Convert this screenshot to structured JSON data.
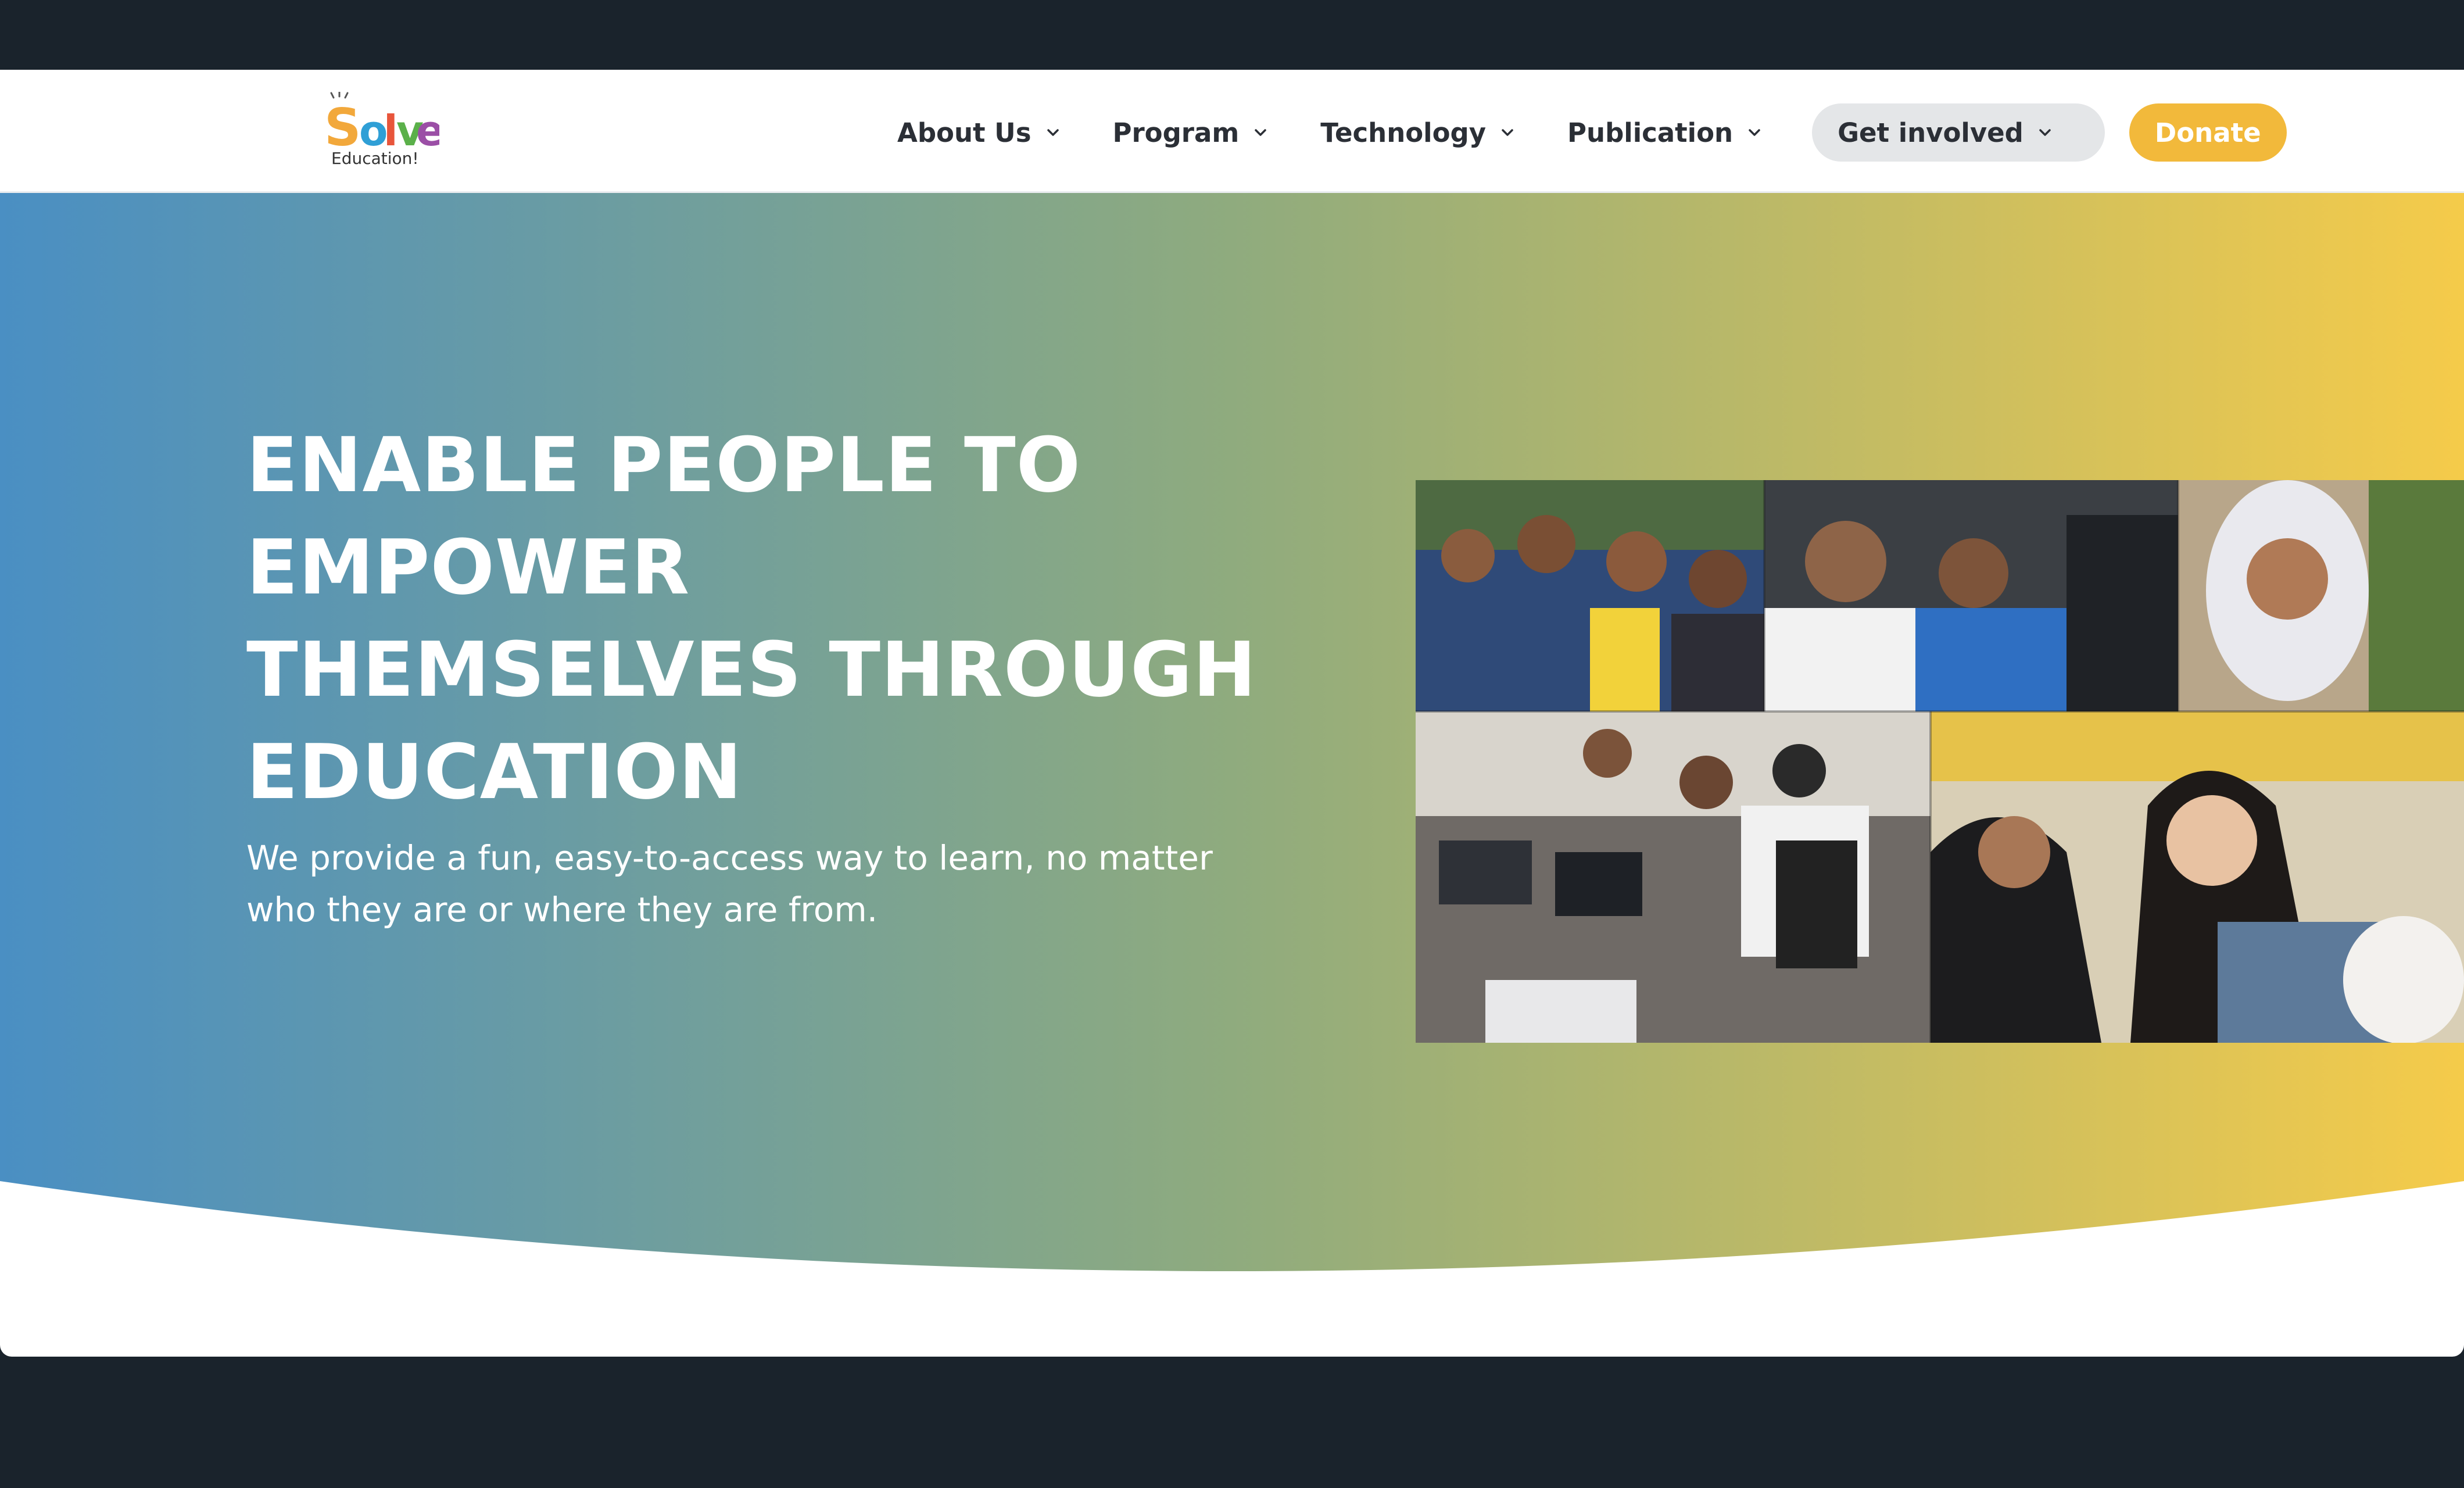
{
  "brand": {
    "logo_main": "Solve",
    "logo_sub": "Education!"
  },
  "nav": {
    "items": [
      {
        "label": "About Us"
      },
      {
        "label": "Program"
      },
      {
        "label": "Technology"
      },
      {
        "label": "Publication"
      }
    ],
    "get_involved": "Get involved",
    "donate": "Donate"
  },
  "hero": {
    "headline_lines": [
      "ENABLE PEOPLE TO",
      "EMPOWER",
      "THEMSELVES THROUGH",
      "EDUCATION"
    ],
    "subtext": "We provide a fun, easy-to-access way to learn, no matter who they are or where they are from."
  },
  "colors": {
    "gradient_start": "#4a8fc3",
    "gradient_mid": "#8fab7e",
    "gradient_end": "#f5cb4a",
    "donate_bg": "#f2b93b",
    "get_involved_bg": "#e4e6e8",
    "page_frame": "#1a232c",
    "nav_text": "#2b2f36"
  },
  "icons": {
    "dropdown": "chevron-down-icon"
  }
}
